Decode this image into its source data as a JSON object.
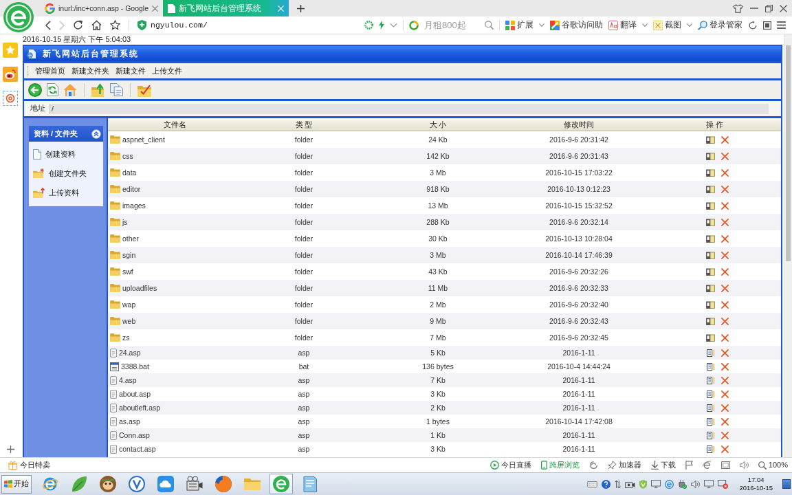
{
  "browser": {
    "tabs": [
      {
        "title": "inurl:/inc+conn.asp - Google",
        "kind": "search",
        "selected": false
      },
      {
        "title": "新飞网站后台管理系统",
        "kind": "page",
        "selected": true
      }
    ],
    "forward_disabled": true,
    "address": "ngyulou.com/",
    "search": {
      "placeholder": "月租800起"
    },
    "tools": [
      {
        "label": "扩展",
        "kind": "extensions",
        "dropdown": true
      },
      {
        "label": "谷歌访问助",
        "kind": "google-assist",
        "dropdown": false
      },
      {
        "label": "翻译",
        "kind": "translate",
        "dropdown": true
      },
      {
        "label": "截图",
        "kind": "screenshot",
        "dropdown": true
      },
      {
        "label": "登录管家",
        "kind": "login",
        "dropdown": false
      }
    ]
  },
  "page": {
    "datetime": "2016-10-15 星期六 下午 5:04:03",
    "title": "新飞网站后台管理系统",
    "menu": [
      "管理首页",
      "新建文件夹",
      "新建文件",
      "上传文件"
    ],
    "address": {
      "label": "地址",
      "value": "/"
    },
    "sidebar": {
      "title": "资料 / 文件夹",
      "expanded": true,
      "items": [
        {
          "label": "创建资料",
          "kind": "document"
        },
        {
          "label": "创建文件夹",
          "kind": "new-folder"
        },
        {
          "label": "上传资料",
          "kind": "upload"
        }
      ]
    },
    "table": {
      "columns": [
        "文件名",
        "类 型",
        "大 小",
        "修改时间",
        "操 作"
      ],
      "rows": [
        {
          "name": "aspnet_client",
          "kind": "folder",
          "type": "folder",
          "size": "24 Kb",
          "modified": "2016-9-6 20:31:42"
        },
        {
          "name": "css",
          "kind": "folder",
          "type": "folder",
          "size": "142 Kb",
          "modified": "2016-9-6 20:31:43"
        },
        {
          "name": "data",
          "kind": "folder",
          "type": "folder",
          "size": "3 Mb",
          "modified": "2016-10-15 17:03:22"
        },
        {
          "name": "editor",
          "kind": "folder",
          "type": "folder",
          "size": "918 Kb",
          "modified": "2016-10-13 0:12:23"
        },
        {
          "name": "images",
          "kind": "folder",
          "type": "folder",
          "size": "13 Mb",
          "modified": "2016-10-15 15:32:52"
        },
        {
          "name": "js",
          "kind": "folder",
          "type": "folder",
          "size": "288 Kb",
          "modified": "2016-9-6 20:32:14"
        },
        {
          "name": "other",
          "kind": "folder",
          "type": "folder",
          "size": "30 Kb",
          "modified": "2016-10-13 10:28:04"
        },
        {
          "name": "sgin",
          "kind": "folder",
          "type": "folder",
          "size": "3 Mb",
          "modified": "2016-10-14 17:46:39"
        },
        {
          "name": "swf",
          "kind": "folder",
          "type": "folder",
          "size": "43 Kb",
          "modified": "2016-9-6 20:32:26"
        },
        {
          "name": "uploadfiles",
          "kind": "folder",
          "type": "folder",
          "size": "11 Mb",
          "modified": "2016-9-6 20:32:33"
        },
        {
          "name": "wap",
          "kind": "folder",
          "type": "folder",
          "size": "2 Mb",
          "modified": "2016-9-6 20:32:40"
        },
        {
          "name": "web",
          "kind": "folder",
          "type": "folder",
          "size": "9 Mb",
          "modified": "2016-9-6 20:32:43"
        },
        {
          "name": "zs",
          "kind": "folder",
          "type": "folder",
          "size": "7 Mb",
          "modified": "2016-9-6 20:32:45"
        },
        {
          "name": "24.asp",
          "kind": "file",
          "type": "asp",
          "size": "5 Kb",
          "modified": "2016-1-11"
        },
        {
          "name": "3388.bat",
          "kind": "batch",
          "type": "bat",
          "size": "136 bytes",
          "modified": "2016-10-4 14:44:24"
        },
        {
          "name": "4.asp",
          "kind": "file",
          "type": "asp",
          "size": "7 Kb",
          "modified": "2016-1-11"
        },
        {
          "name": "about.asp",
          "kind": "file",
          "type": "asp",
          "size": "3 Kb",
          "modified": "2016-1-11"
        },
        {
          "name": "aboutleft.asp",
          "kind": "file",
          "type": "asp",
          "size": "2 Kb",
          "modified": "2016-1-11"
        },
        {
          "name": "as.asp",
          "kind": "file",
          "type": "asp",
          "size": "1 bytes",
          "modified": "2016-10-14 17:42:08"
        },
        {
          "name": "Conn.asp",
          "kind": "file",
          "type": "asp",
          "size": "1 Kb",
          "modified": "2016-1-11"
        },
        {
          "name": "contact.asp",
          "kind": "file",
          "type": "asp",
          "size": "3 Kb",
          "modified": "2016-1-11"
        }
      ]
    }
  },
  "status_bar": {
    "left": "今日特卖",
    "items": [
      {
        "label": "今日直播",
        "kind": "live"
      },
      {
        "label": "跨屏浏览",
        "kind": "cross-screen"
      },
      {
        "kind": "refresh"
      },
      {
        "label": "加速器",
        "kind": "accelerator"
      },
      {
        "label": "下载",
        "kind": "download"
      },
      {
        "kind": "flag"
      },
      {
        "kind": "browser"
      },
      {
        "kind": "window"
      },
      {
        "kind": "sound"
      },
      {
        "label": "100%",
        "kind": "zoom"
      }
    ]
  },
  "taskbar": {
    "start": "开始",
    "apps": [
      {
        "kind": "e-globe",
        "selected": false
      },
      {
        "kind": "leaf",
        "selected": false
      },
      {
        "kind": "monkey",
        "selected": false
      },
      {
        "kind": "v-circle",
        "selected": false
      },
      {
        "kind": "cloud",
        "selected": false
      },
      {
        "kind": "film",
        "selected": false
      },
      {
        "kind": "fox",
        "selected": false
      },
      {
        "kind": "folder",
        "selected": false
      },
      {
        "kind": "green-e",
        "selected": true
      },
      {
        "kind": "notebook",
        "selected": false
      }
    ],
    "time": "17:04",
    "date": "2016-10-15"
  }
}
